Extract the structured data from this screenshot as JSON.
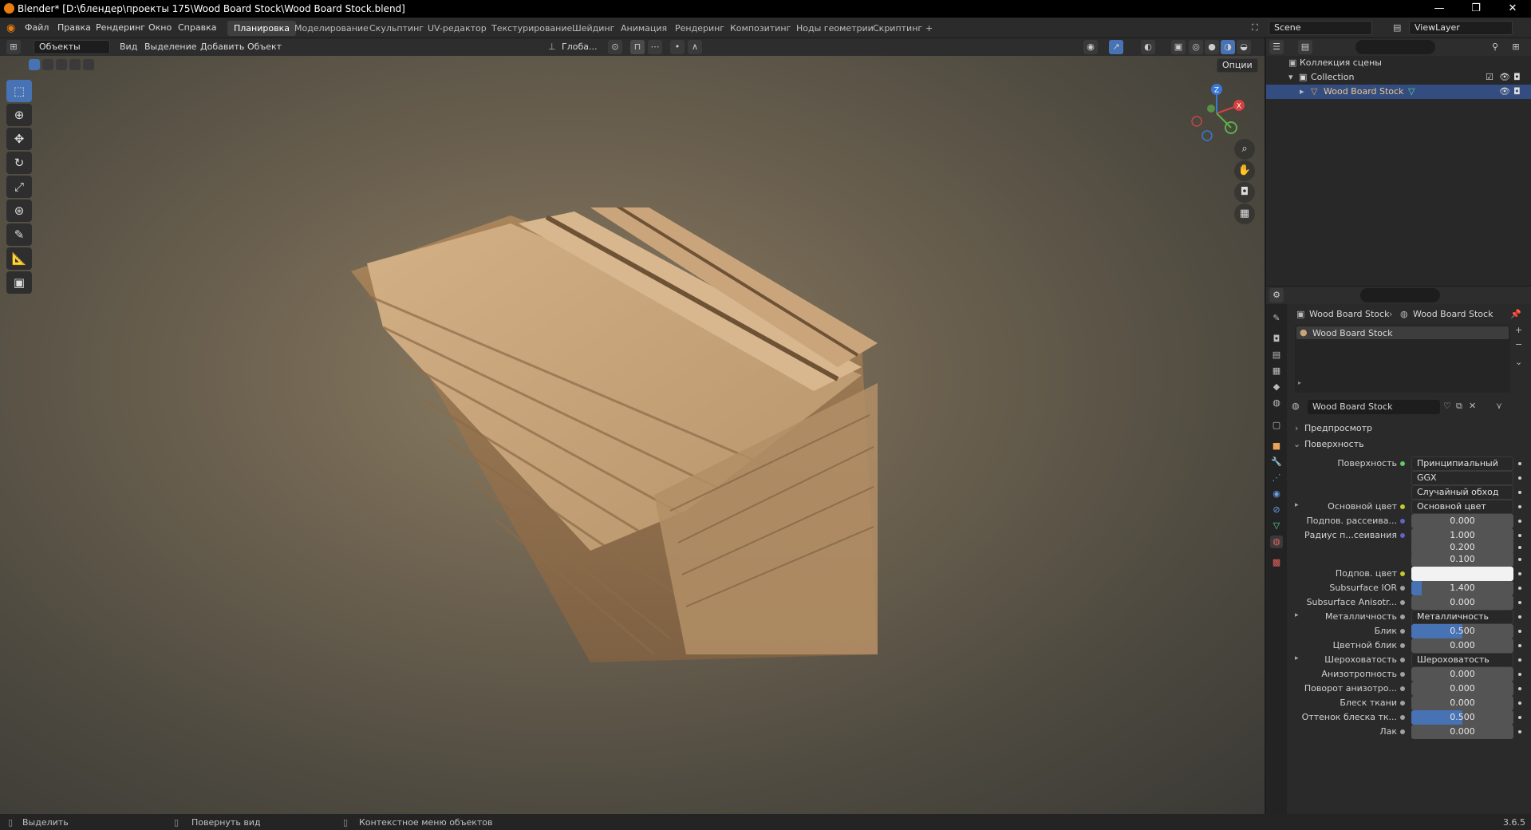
{
  "window": {
    "title": "Blender* [D:\\блендер\\проекты 175\\Wood Board Stock\\Wood Board Stock.blend]",
    "minimize": "—",
    "maximize": "❐",
    "close": "✕"
  },
  "menu": [
    "Файл",
    "Правка",
    "Рендеринг",
    "Окно",
    "Справка"
  ],
  "workspaces": [
    "Планировка",
    "Моделирование",
    "Скульптинг",
    "UV-редактор",
    "Текстурирование",
    "Шейдинг",
    "Анимация",
    "Рендеринг",
    "Композитинг",
    "Ноды геометрии",
    "Скриптинг"
  ],
  "active_workspace": "Планировка",
  "add_tab": "+",
  "scene": "Scene",
  "view_layer": "ViewLayer",
  "viewport_header": {
    "mode": "Объекты",
    "items": [
      "Вид",
      "Выделение",
      "Добавить",
      "Объект"
    ],
    "orientation": "Глоба...",
    "options": "Опции"
  },
  "gizmo": {
    "x": "X",
    "y": "Y",
    "z": "Z"
  },
  "outliner": {
    "root": "Коллекция сцены",
    "collection": "Collection",
    "object": "Wood Board Stock"
  },
  "properties": {
    "breadcrumb_object": "Wood Board Stock",
    "breadcrumb_material": "Wood Board Stock",
    "slot_name": "Wood Board Stock",
    "material_name": "Wood Board Stock",
    "panel_preview": "Предпросмотр",
    "panel_surface": "Поверхность",
    "rows": [
      {
        "label": "Поверхность",
        "type": "linked",
        "value": "Принципиальный BSDF",
        "dot": "#63c763"
      },
      {
        "label": "",
        "type": "select",
        "value": "GGX"
      },
      {
        "label": "",
        "type": "select",
        "value": "Случайный обход"
      },
      {
        "label": "Основной цвет",
        "type": "linked",
        "value": "Основной цвет",
        "dot": "#c7c729",
        "expand": true
      },
      {
        "label": "Подпов. рассеива...",
        "type": "num",
        "value": "0.000",
        "fill": 0,
        "dot": "#6363c7"
      },
      {
        "label": "Радиус п...сеивания",
        "type": "num",
        "value": "1.000",
        "fill": 0,
        "dot": "#6363c7"
      },
      {
        "label": "",
        "type": "num",
        "value": "0.200",
        "fill": 0
      },
      {
        "label": "",
        "type": "num",
        "value": "0.100",
        "fill": 0
      },
      {
        "label": "Подпов. цвет",
        "type": "color",
        "value": "",
        "dot": "#c7c729"
      },
      {
        "label": "Subsurface IOR",
        "type": "num",
        "value": "1.400",
        "fill": 0.1,
        "dot": "#a1a1a1"
      },
      {
        "label": "Subsurface Anisotr...",
        "type": "num",
        "value": "0.000",
        "fill": 0,
        "dot": "#a1a1a1"
      },
      {
        "label": "Металличность",
        "type": "linked",
        "value": "Металличность",
        "dot": "#a1a1a1",
        "expand": true
      },
      {
        "label": "Блик",
        "type": "num",
        "value": "0.500",
        "fill": 0.5,
        "dot": "#a1a1a1"
      },
      {
        "label": "Цветной блик",
        "type": "num",
        "value": "0.000",
        "fill": 0,
        "dot": "#a1a1a1"
      },
      {
        "label": "Шероховатость",
        "type": "linked",
        "value": "Шероховатость",
        "dot": "#a1a1a1",
        "expand": true
      },
      {
        "label": "Анизотропность",
        "type": "num",
        "value": "0.000",
        "fill": 0,
        "dot": "#a1a1a1"
      },
      {
        "label": "Поворот анизотро...",
        "type": "num",
        "value": "0.000",
        "fill": 0,
        "dot": "#a1a1a1"
      },
      {
        "label": "Блеск ткани",
        "type": "num",
        "value": "0.000",
        "fill": 0,
        "dot": "#a1a1a1"
      },
      {
        "label": "Оттенок блеска тк...",
        "type": "num",
        "value": "0.500",
        "fill": 0.5,
        "dot": "#a1a1a1"
      },
      {
        "label": "Лак",
        "type": "num",
        "value": "0.000",
        "fill": 0,
        "dot": "#a1a1a1"
      }
    ]
  },
  "status": {
    "select": "Выделить",
    "rotate": "Повернуть вид",
    "context": "Контекстное меню объектов",
    "version": "3.6.5"
  },
  "colors": {
    "accent": "#4772b3",
    "wood": "#c9a57a"
  }
}
